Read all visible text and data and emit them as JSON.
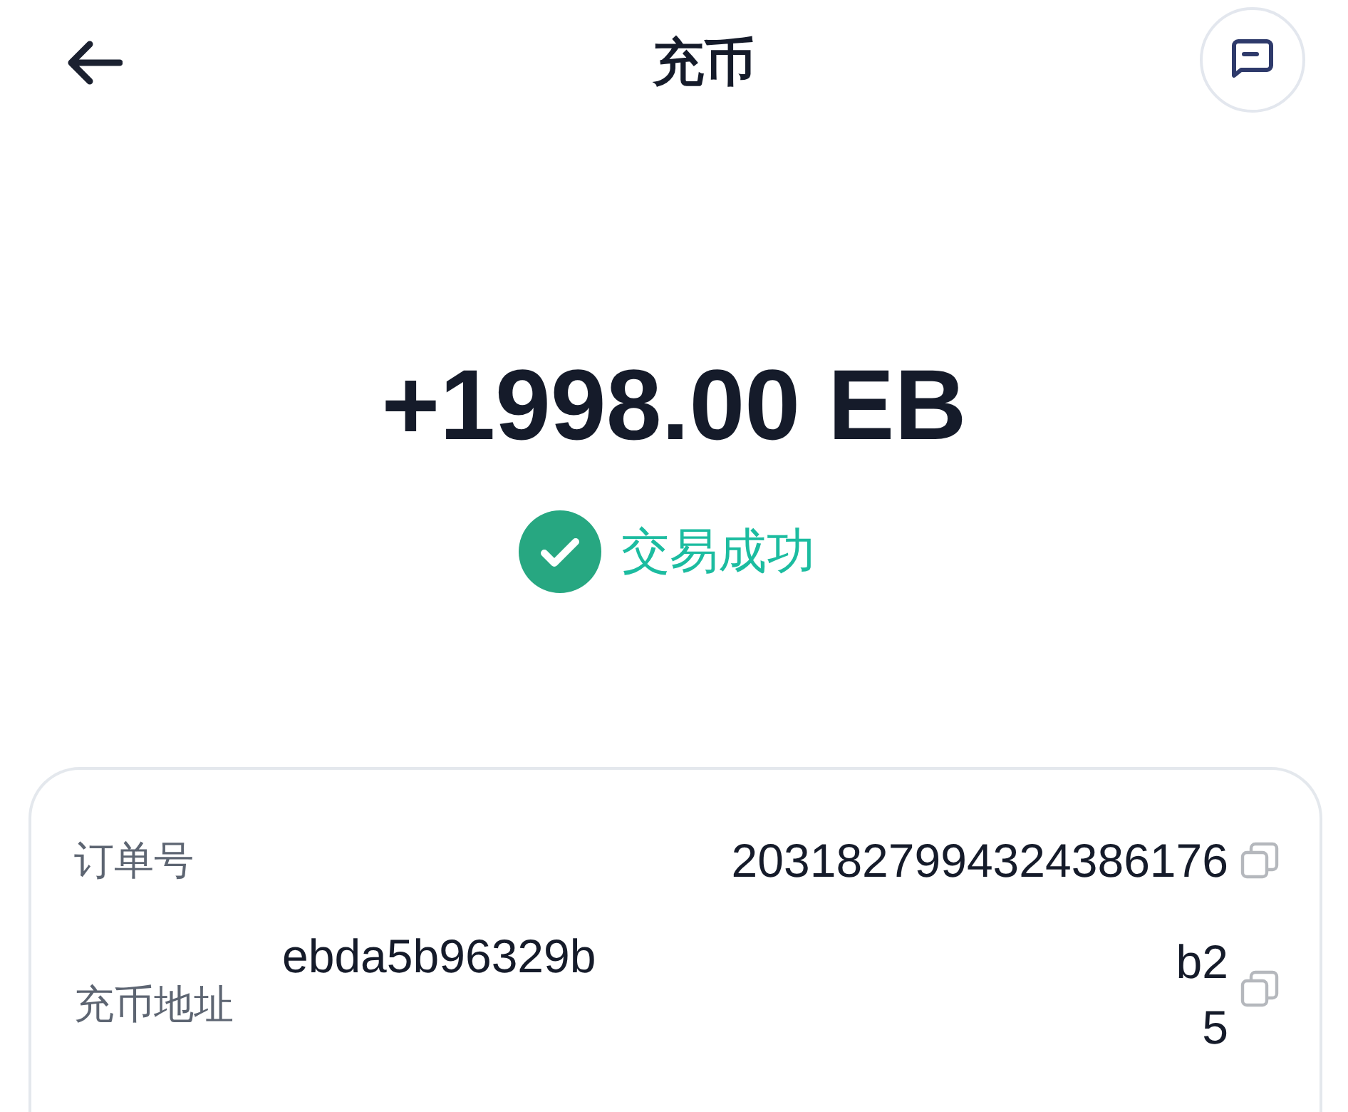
{
  "header": {
    "title": "充币"
  },
  "amount": "+1998.00 EB",
  "status": {
    "kind": "success",
    "text": "交易成功"
  },
  "details": [
    {
      "kind": "single",
      "label": "订单号",
      "value": "2031827994324386176"
    },
    {
      "kind": "split",
      "label": "充币地址",
      "value_start": "ebda5b96329b",
      "value_end": [
        "b2",
        "5"
      ]
    }
  ]
}
